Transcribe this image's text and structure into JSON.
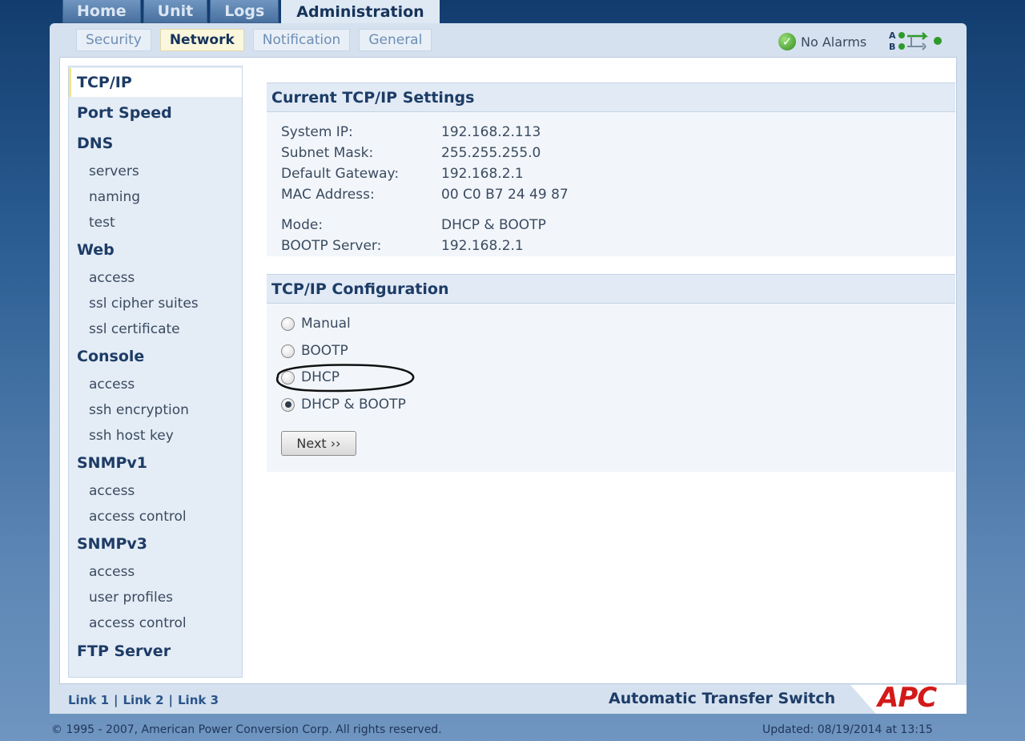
{
  "top_tabs": [
    {
      "label": "Home"
    },
    {
      "label": "Unit"
    },
    {
      "label": "Logs"
    },
    {
      "label": "Administration",
      "active": true
    }
  ],
  "sub_tabs": [
    {
      "label": "Security"
    },
    {
      "label": "Network",
      "active": true
    },
    {
      "label": "Notification"
    },
    {
      "label": "General"
    }
  ],
  "status": {
    "alarm_text": "No Alarms",
    "alarm_icon": "check-circle-icon",
    "source_icon": "ab-source-icon"
  },
  "sidebar": {
    "items": [
      {
        "label": "TCP/IP",
        "type": "heading",
        "active": true
      },
      {
        "label": "Port Speed",
        "type": "heading"
      },
      {
        "label": "DNS",
        "type": "heading"
      },
      {
        "label": "servers",
        "type": "sub"
      },
      {
        "label": "naming",
        "type": "sub"
      },
      {
        "label": "test",
        "type": "sub"
      },
      {
        "label": "Web",
        "type": "heading"
      },
      {
        "label": "access",
        "type": "sub"
      },
      {
        "label": "ssl cipher suites",
        "type": "sub"
      },
      {
        "label": "ssl certificate",
        "type": "sub"
      },
      {
        "label": "Console",
        "type": "heading"
      },
      {
        "label": "access",
        "type": "sub"
      },
      {
        "label": "ssh encryption",
        "type": "sub"
      },
      {
        "label": "ssh host key",
        "type": "sub"
      },
      {
        "label": "SNMPv1",
        "type": "heading"
      },
      {
        "label": "access",
        "type": "sub"
      },
      {
        "label": "access control",
        "type": "sub"
      },
      {
        "label": "SNMPv3",
        "type": "heading"
      },
      {
        "label": "access",
        "type": "sub"
      },
      {
        "label": "user profiles",
        "type": "sub"
      },
      {
        "label": "access control",
        "type": "sub"
      },
      {
        "label": "FTP Server",
        "type": "heading"
      }
    ]
  },
  "current_settings": {
    "title": "Current TCP/IP Settings",
    "rows": [
      {
        "label": "System IP:",
        "value": "192.168.2.113"
      },
      {
        "label": "Subnet Mask:",
        "value": "255.255.255.0"
      },
      {
        "label": "Default Gateway:",
        "value": "192.168.2.1"
      },
      {
        "label": "MAC Address:",
        "value": "00 C0 B7 24 49 87"
      },
      {
        "label": "Mode:",
        "value": "DHCP & BOOTP"
      },
      {
        "label": "BOOTP Server:",
        "value": "192.168.2.1"
      }
    ]
  },
  "configuration": {
    "title": "TCP/IP Configuration",
    "options": [
      {
        "label": "Manual",
        "checked": false
      },
      {
        "label": "BOOTP",
        "checked": false
      },
      {
        "label": "DHCP",
        "checked": false
      },
      {
        "label": "DHCP & BOOTP",
        "checked": true
      }
    ],
    "next_label": "Next ››"
  },
  "footer": {
    "links": [
      "Link 1",
      "Link 2",
      "Link 3"
    ],
    "link_separator": "|",
    "product": "Automatic Transfer Switch",
    "logo": "APC",
    "copyright": "© 1995 - 2007, American Power Conversion Corp. All rights reserved.",
    "updated": "Updated: 08/19/2014 at 13:15"
  },
  "colors": {
    "brand_red": "#d31a1a",
    "header_blue": "#1d3c66",
    "active_tab": "#fbf7dc"
  }
}
